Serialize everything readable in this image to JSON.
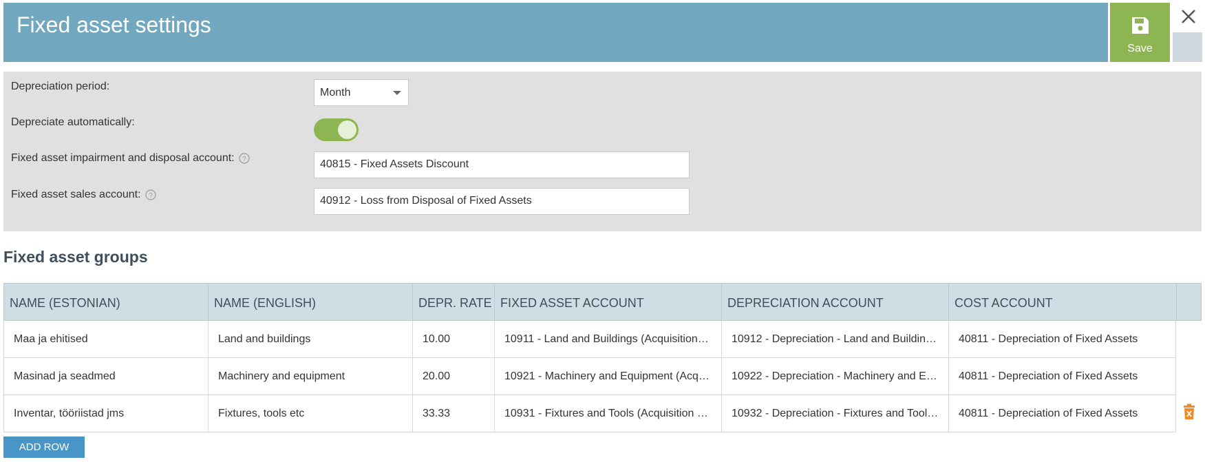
{
  "header": {
    "title": "Fixed asset settings",
    "save_label": "Save"
  },
  "settings": {
    "depreciation_period": {
      "label": "Depreciation period:",
      "value": "Month"
    },
    "depreciate_auto": {
      "label": "Depreciate automatically:",
      "checked": true
    },
    "impairment_account": {
      "label": "Fixed asset impairment and disposal account:",
      "value": "40815 - Fixed Assets Discount"
    },
    "sales_account": {
      "label": "Fixed asset sales account:",
      "value": "40912 - Loss from Disposal of Fixed Assets"
    }
  },
  "groups": {
    "title": "Fixed asset groups",
    "columns": [
      "NAME (ESTONIAN)",
      "NAME (ENGLISH)",
      "DEPR. RATE",
      "FIXED ASSET ACCOUNT",
      "DEPRECIATION ACCOUNT",
      "COST ACCOUNT"
    ],
    "rows": [
      [
        "Maa ja ehitised",
        "Land and buildings",
        "10.00",
        "10911 - Land and Buildings (Acquisition…",
        "10912 - Depreciation - Land and Buildin…",
        "40811 - Depreciation of Fixed Assets"
      ],
      [
        "Masinad ja seadmed",
        "Machinery and equipment",
        "20.00",
        "10921 - Machinery and Equipment (Acq…",
        "10922 - Depreciation - Machinery and E…",
        "40811 - Depreciation of Fixed Assets"
      ],
      [
        "Inventar, tööriistad jms",
        "Fixtures, tools etc",
        "33.33",
        "10931 - Fixtures and Tools (Acquisition …",
        "10932 - Depreciation - Fixtures and Tool…",
        "40811 - Depreciation of Fixed Assets"
      ]
    ],
    "add_row_label": "ADD ROW"
  },
  "colors": {
    "header": "#72a8bf",
    "save": "#8db552",
    "add_row": "#4a95c8",
    "trash": "#f08a24"
  }
}
